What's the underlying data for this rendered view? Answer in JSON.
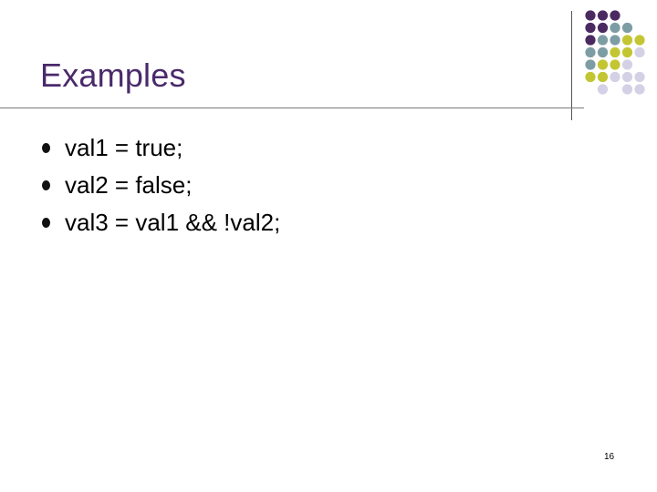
{
  "slide": {
    "title": "Examples",
    "bullets": [
      "val1 = true;",
      "val2 = false;",
      "val3 = val1 && !val2;"
    ],
    "page_number": "16"
  },
  "decoration": {
    "dot_colors": {
      "purple": "#4b2a62",
      "teal": "#7d9da5",
      "olive": "#c3c632",
      "lavender": "#d4d1e6"
    },
    "dot_rows": [
      [
        "purple",
        "purple",
        "purple",
        "",
        ""
      ],
      [
        "purple",
        "purple",
        "teal",
        "teal",
        ""
      ],
      [
        "purple",
        "teal",
        "teal",
        "olive",
        "olive"
      ],
      [
        "teal",
        "teal",
        "olive",
        "olive",
        "lavender"
      ],
      [
        "teal",
        "olive",
        "olive",
        "lavender",
        ""
      ],
      [
        "olive",
        "olive",
        "lavender",
        "lavender",
        "lavender"
      ],
      [
        "",
        "lavender",
        "",
        "lavender",
        "lavender"
      ]
    ]
  }
}
